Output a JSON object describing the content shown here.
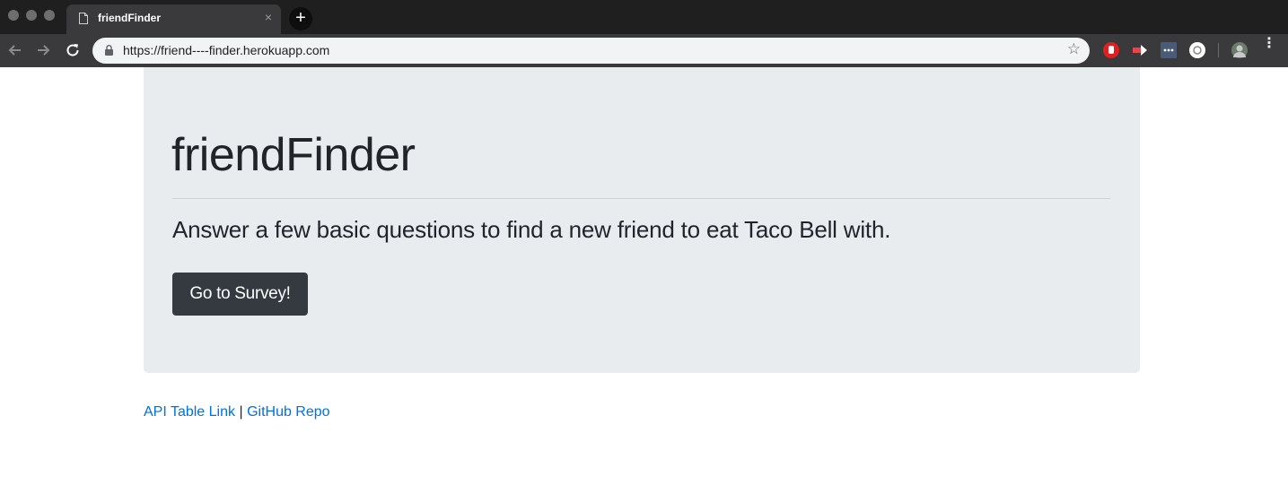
{
  "browser": {
    "tab_title": "friendFinder",
    "tab_close": "×",
    "new_tab": "+",
    "url": "https://friend----finder.herokuapp.com",
    "star": "☆",
    "menu": "⋮"
  },
  "jumbotron": {
    "title": "friendFinder",
    "lead": "Answer a few basic questions to find a new friend to eat Taco Bell with.",
    "button_label": "Go to Survey!"
  },
  "footer": {
    "api_link": "API Table Link",
    "separator": "|",
    "github_link": "GitHub Repo"
  },
  "colors": {
    "jumbotron_bg": "#e9ecef",
    "button_bg": "#343a40",
    "link": "#0070e0"
  }
}
